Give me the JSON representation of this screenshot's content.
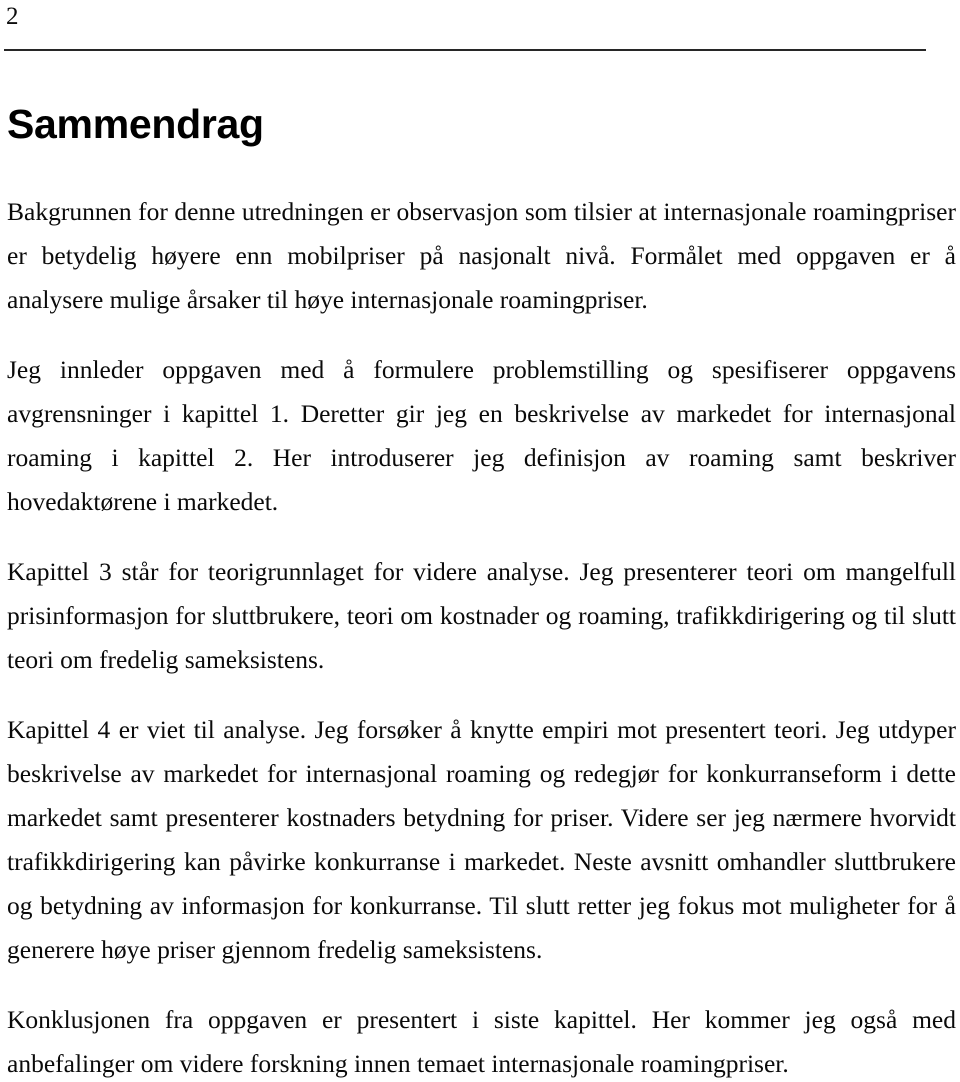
{
  "document": {
    "page_number": "2",
    "heading": "Sammendrag",
    "paragraphs": [
      "Bakgrunnen for denne utredningen er observasjon som tilsier at internasjonale roamingpriser er betydelig høyere enn mobilpriser på nasjonalt nivå. Formålet med oppgaven er å analysere mulige årsaker til høye internasjonale roamingpriser.",
      "Jeg innleder oppgaven med å formulere problemstilling og spesifiserer oppgavens avgrensninger i kapittel 1. Deretter gir jeg en beskrivelse av markedet for internasjonal roaming i kapittel 2. Her introduserer jeg definisjon av roaming samt beskriver hovedaktørene i markedet.",
      "Kapittel 3 står for teorigrunnlaget for videre analyse. Jeg presenterer teori om mangelfull prisinformasjon for sluttbrukere, teori om kostnader og roaming, trafikkdirigering og til slutt teori om fredelig sameksistens.",
      "Kapittel 4 er viet til analyse. Jeg forsøker å knytte empiri mot presentert teori. Jeg utdyper beskrivelse av markedet for internasjonal roaming og redegjør for konkurranseform i dette markedet samt presenterer kostnaders betydning for priser. Videre ser jeg nærmere hvorvidt trafikkdirigering kan påvirke konkurranse i markedet. Neste avsnitt omhandler sluttbrukere og betydning av informasjon for konkurranse. Til slutt retter jeg fokus mot muligheter for å generere høye priser gjennom fredelig sameksistens.",
      "Konklusjonen fra oppgaven er presentert i siste kapittel. Her kommer jeg også med anbefalinger om videre forskning innen temaet internasjonale roamingpriser."
    ]
  },
  "colors": {
    "text": "#0a0a0a",
    "rule": "#272727",
    "background": "#ffffff"
  }
}
